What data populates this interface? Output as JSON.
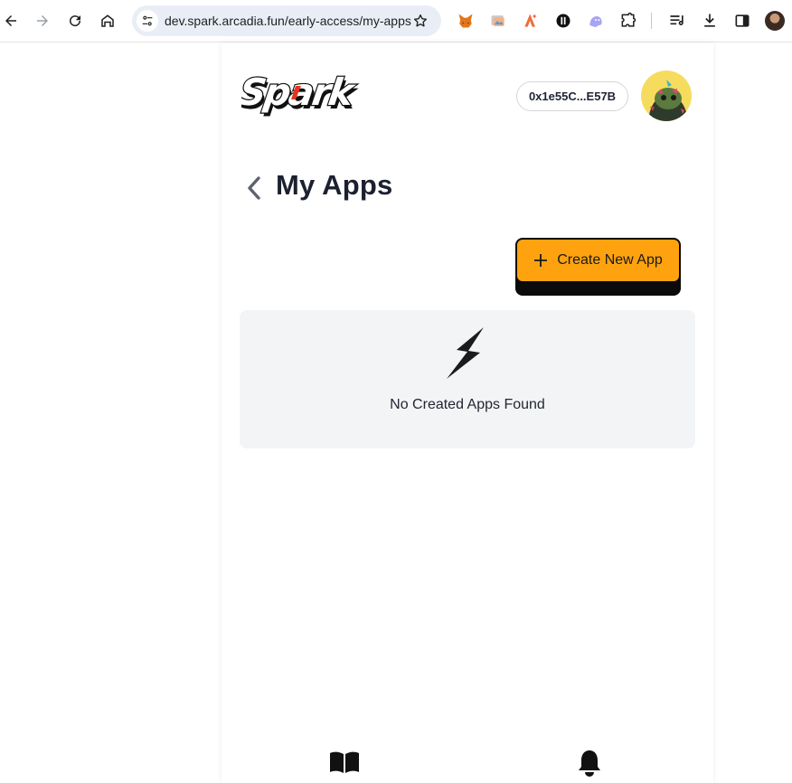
{
  "browser": {
    "url": "dev.spark.arcadia.fun/early-access/my-apps",
    "icons": {
      "back": "arrow-left-icon",
      "forward": "arrow-right-icon",
      "reload": "reload-icon",
      "home": "home-icon",
      "site_info": "tune-icon",
      "bookmark": "star-icon",
      "extensions": [
        "metamask-fox-icon",
        "image-extension-icon",
        "bolt-extension-icon",
        "hashflow-icon",
        "ghost-icon",
        "puzzle-icon"
      ],
      "reading_list": "reading-list-icon",
      "downloads": "download-icon",
      "side_panel": "side-panel-icon"
    }
  },
  "header": {
    "logo_text": "Spark",
    "wallet_address": "0x1e55C...E57B"
  },
  "page": {
    "title": "My Apps",
    "create_button_label": "Create New App",
    "empty_state_text": "No Created Apps Found"
  },
  "bottom_nav": {
    "items": [
      "book-icon",
      "bell-icon"
    ]
  },
  "colors": {
    "accent": "#ffa20f",
    "title": "#1c2030",
    "card_bg": "#f3f4f6",
    "omnibox_bg": "#e9eef6"
  }
}
